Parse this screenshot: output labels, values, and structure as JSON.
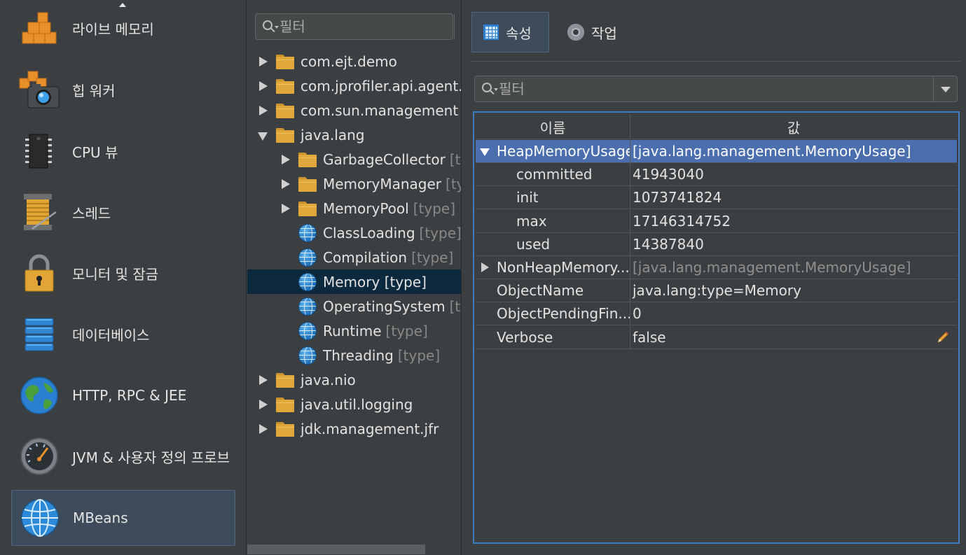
{
  "nav": {
    "items": [
      {
        "label": "라이브 메모리",
        "icon": "live-memory-icon"
      },
      {
        "label": "힙 워커",
        "icon": "heap-walker-icon"
      },
      {
        "label": "CPU 뷰",
        "icon": "cpu-icon"
      },
      {
        "label": "스레드",
        "icon": "threads-icon"
      },
      {
        "label": "모니터 및 잠금",
        "icon": "lock-icon"
      },
      {
        "label": "데이터베이스",
        "icon": "database-icon"
      },
      {
        "label": "HTTP, RPC & JEE",
        "icon": "globe-icon"
      },
      {
        "label": "JVM & 사용자 정의 프로브",
        "icon": "gauge-icon"
      },
      {
        "label": "MBeans",
        "icon": "mbeans-globe-icon",
        "active": true
      }
    ]
  },
  "tree": {
    "filter_placeholder": "필터",
    "nodes": [
      {
        "label": "com.ejt.demo",
        "kind": "folder",
        "state": "collapsed",
        "level": 0
      },
      {
        "label": "com.jprofiler.api.agent.m",
        "kind": "folder",
        "state": "collapsed",
        "level": 0
      },
      {
        "label": "com.sun.management",
        "kind": "folder",
        "state": "collapsed",
        "level": 0
      },
      {
        "label": "java.lang",
        "kind": "folder",
        "state": "expanded",
        "level": 0
      },
      {
        "label": "GarbageCollector",
        "suffix": "[typ",
        "kind": "folder",
        "state": "collapsed",
        "level": 1
      },
      {
        "label": "MemoryManager",
        "suffix": "[typ",
        "kind": "folder",
        "state": "collapsed",
        "level": 1
      },
      {
        "label": "MemoryPool",
        "suffix": "[type]",
        "kind": "folder",
        "state": "collapsed",
        "level": 1
      },
      {
        "label": "ClassLoading",
        "suffix": "[type]",
        "kind": "bean",
        "level": 1
      },
      {
        "label": "Compilation",
        "suffix": "[type]",
        "kind": "bean",
        "level": 1
      },
      {
        "label": "Memory [type]",
        "kind": "bean",
        "level": 1,
        "selected": true
      },
      {
        "label": "OperatingSystem",
        "suffix": "[typ",
        "kind": "bean",
        "level": 1
      },
      {
        "label": "Runtime",
        "suffix": "[type]",
        "kind": "bean",
        "level": 1
      },
      {
        "label": "Threading",
        "suffix": "[type]",
        "kind": "bean",
        "level": 1
      },
      {
        "label": "java.nio",
        "kind": "folder",
        "state": "collapsed",
        "level": 0
      },
      {
        "label": "java.util.logging",
        "kind": "folder",
        "state": "collapsed",
        "level": 0
      },
      {
        "label": "jdk.management.jfr",
        "kind": "folder",
        "state": "collapsed",
        "level": 0
      }
    ]
  },
  "tabs": {
    "attributes": "속성",
    "operations": "작업"
  },
  "attr_filter_placeholder": "필터",
  "table": {
    "col_name": "이름",
    "col_value": "값",
    "rows": [
      {
        "name": "HeapMemoryUsage",
        "value": "[java.lang.management.MemoryUsage]",
        "expander": "down",
        "indent": 0,
        "highlight": true
      },
      {
        "name": "committed",
        "value": "41943040",
        "indent": 1
      },
      {
        "name": "init",
        "value": "1073741824",
        "indent": 1
      },
      {
        "name": "max",
        "value": "17146314752",
        "indent": 1
      },
      {
        "name": "used",
        "value": "14387840",
        "indent": 1
      },
      {
        "name": "NonHeapMemory...",
        "value": "[java.lang.management.MemoryUsage]",
        "expander": "right",
        "indent": 0,
        "dim_value": true
      },
      {
        "name": "ObjectName",
        "value": "java.lang:type=Memory",
        "indent": 0
      },
      {
        "name": "ObjectPendingFin...",
        "value": "0",
        "indent": 0
      },
      {
        "name": "Verbose",
        "value": "false",
        "indent": 0,
        "editable": true
      }
    ]
  },
  "colors": {
    "accent": "#4b6eaf",
    "selection_tree": "#0d293e",
    "folder": "#e0a83a",
    "background": "#3c3f41"
  }
}
